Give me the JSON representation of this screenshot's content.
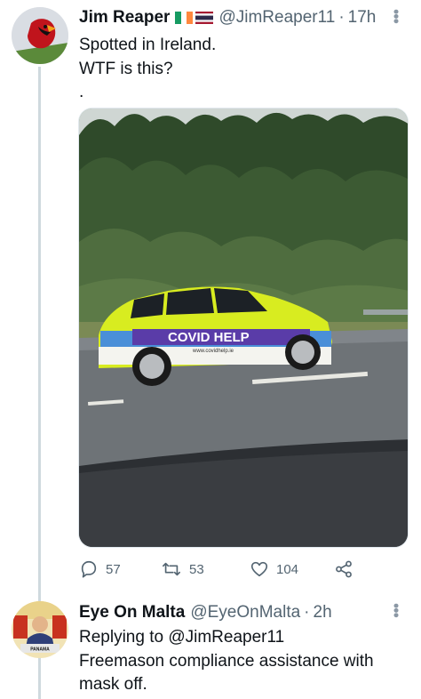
{
  "tweet1": {
    "name": "Jim Reaper",
    "handle": "@JimReaper11",
    "dot": "·",
    "time": "17h",
    "flags": [
      "ireland-flag",
      "thailand-flag"
    ],
    "more_icon": "more-options-icon",
    "text_line1": "Spotted in Ireland.",
    "text_line2": "WTF is this?",
    "text_line3": ".",
    "media": {
      "car_text": "COVID HELP",
      "car_subtext": "www.covidhelp.ie",
      "body_color": "#d8ec20",
      "stripe_color": "#5a3ca8"
    },
    "actions": {
      "replies": "57",
      "retweets": "53",
      "likes": "104",
      "reply_icon": "reply-icon",
      "retweet_icon": "retweet-icon",
      "like_icon": "heart-icon",
      "share_icon": "share-icon"
    }
  },
  "tweet2": {
    "name": "Eye On Malta",
    "handle": "@EyeOnMalta",
    "dot": "·",
    "time": "2h",
    "replying_prefix": "Replying to",
    "replying_handle": "@JimReaper11",
    "text_line1": "Freemason compliance assistance with",
    "text_line2": "mask off.",
    "more_icon": "more-options-icon"
  },
  "colors": {
    "text": "#0f1419",
    "muted": "#536471",
    "thread_line": "#cfd9de"
  }
}
